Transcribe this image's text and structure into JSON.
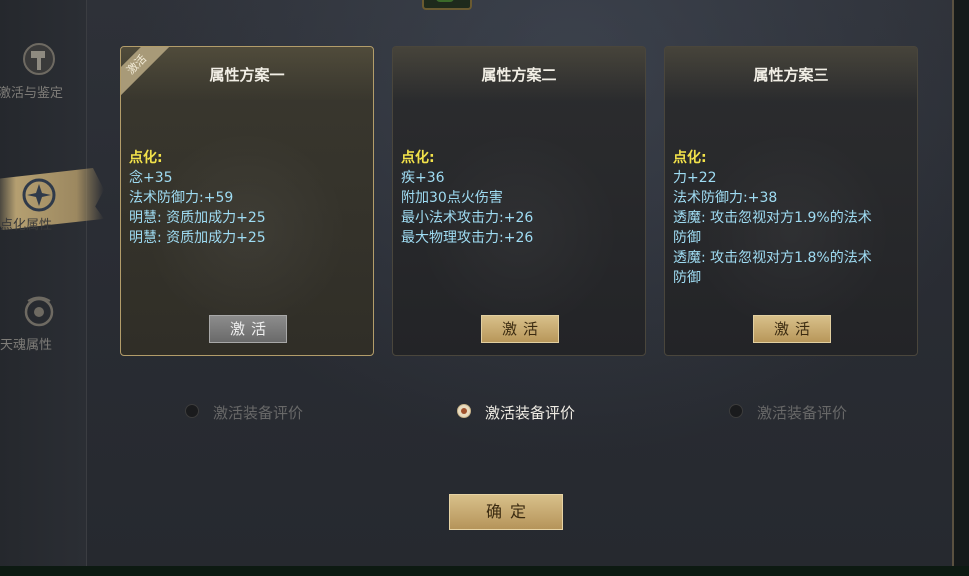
{
  "sidebar": {
    "items": [
      {
        "label": "激活与鉴定",
        "icon": "hammer-icon",
        "active": false
      },
      {
        "label": "点化属性",
        "icon": "sparkle-icon",
        "active": true
      },
      {
        "label": "天魂属性",
        "icon": "spirit-icon",
        "active": false
      }
    ]
  },
  "cards": [
    {
      "title": "属性方案一",
      "ribbon": "激活",
      "heading": "点化:",
      "lines": [
        "念+35",
        "法术防御力:+59",
        "明慧: 资质加成力+25",
        "明慧: 资质加成力+25"
      ],
      "button": "激活",
      "button_enabled": false
    },
    {
      "title": "属性方案二",
      "heading": "点化:",
      "lines": [
        "疾+36",
        "附加30点火伤害",
        "最小法术攻击力:+26",
        "最大物理攻击力:+26"
      ],
      "button": "激活",
      "button_enabled": true
    },
    {
      "title": "属性方案三",
      "heading": "点化:",
      "lines": [
        "力+22",
        "法术防御力:+38",
        "透魔: 攻击忽视对方1.9%的法术",
        "防御",
        "透魔: 攻击忽视对方1.8%的法术",
        "防御"
      ],
      "button": "激活",
      "button_enabled": true
    }
  ],
  "radios": [
    {
      "label": "激活装备评价",
      "selected": false
    },
    {
      "label": "激活装备评价",
      "selected": true
    },
    {
      "label": "激活装备评价",
      "selected": false
    }
  ],
  "confirm_label": "确定",
  "colors": {
    "accent_gold": "#c9a96a",
    "attr_text": "#9fdcf3",
    "heading_yellow": "#f2e24a"
  }
}
